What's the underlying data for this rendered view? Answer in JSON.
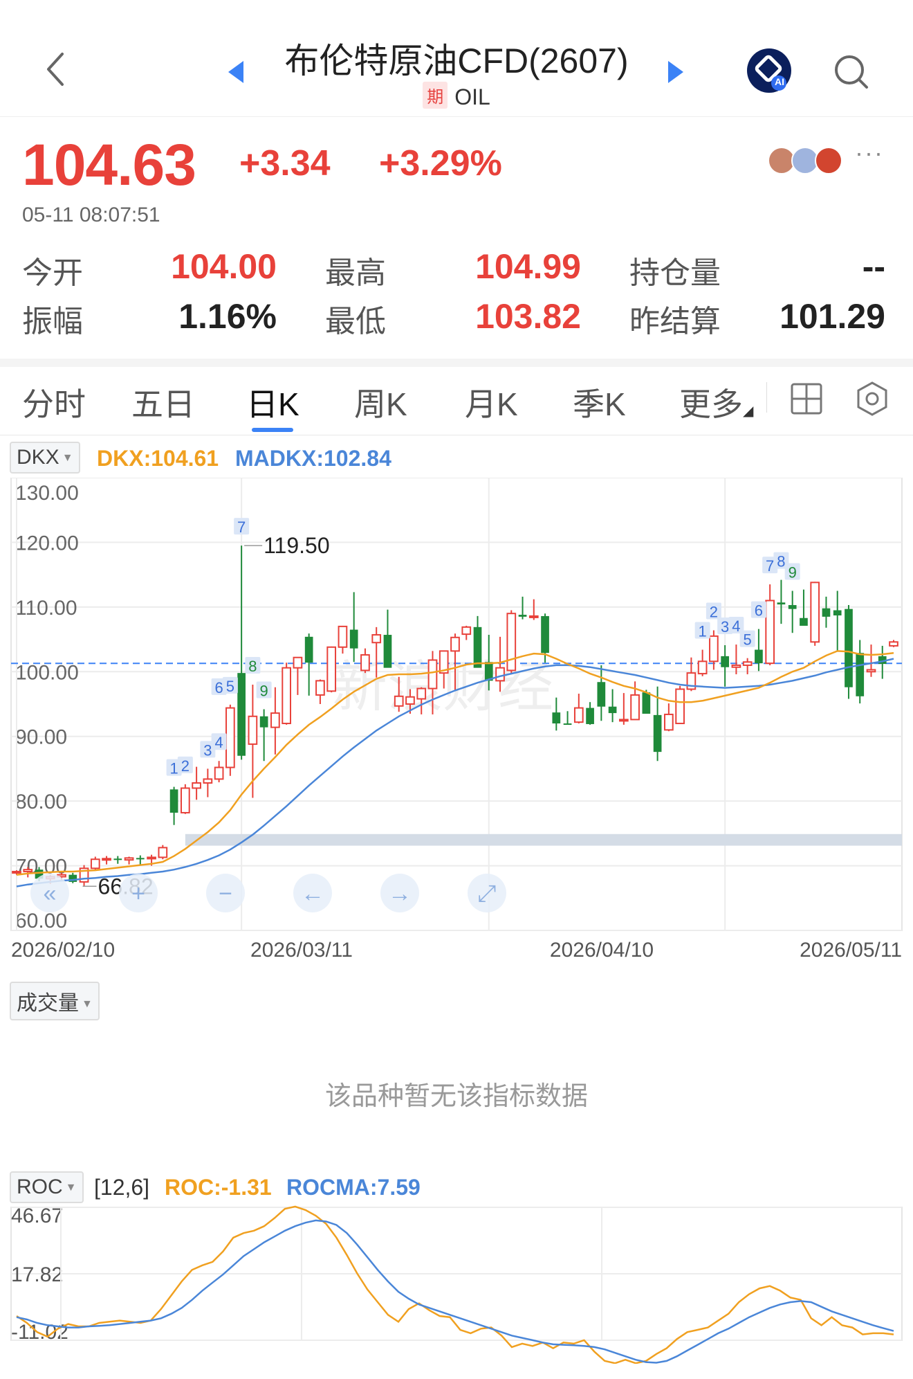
{
  "header": {
    "title": "布伦特原油CFD(2607)",
    "badge": "期",
    "symbol": "OIL",
    "ai_label": "AI"
  },
  "quote": {
    "price": "104.63",
    "change": "+3.34",
    "change_pct": "+3.29%",
    "timestamp": "05-11 08:07:51",
    "more": "···"
  },
  "stats": [
    {
      "label": "今开",
      "value": "104.00",
      "color": "#e8413a"
    },
    {
      "label": "最高",
      "value": "104.99",
      "color": "#e8413a"
    },
    {
      "label": "持仓量",
      "value": "--",
      "color": "#222222"
    },
    {
      "label": "振幅",
      "value": "1.16%",
      "color": "#222222"
    },
    {
      "label": "最低",
      "value": "103.82",
      "color": "#e8413a"
    },
    {
      "label": "昨结算",
      "value": "101.29",
      "color": "#222222"
    }
  ],
  "tabs": [
    "分时",
    "五日",
    "日K",
    "周K",
    "月K",
    "季K",
    "更多"
  ],
  "active_tab": "日K",
  "main_indicator": {
    "name": "DKX",
    "dkx": "DKX:104.61",
    "madkx": "MADKX:102.84",
    "dkx_color": "#f0a020",
    "madkx_color": "#4a86d8"
  },
  "volume_indicator": {
    "name": "成交量",
    "no_data": "该品种暂无该指标数据"
  },
  "roc_indicator": {
    "name": "ROC",
    "params": "[12,6]",
    "roc": "ROC:-1.31",
    "rocma": "ROCMA:7.59"
  },
  "chart_data": [
    {
      "type": "candlestick",
      "y_ticks": [
        "130.00",
        "120.00",
        "110.00",
        "100.00",
        "90.00",
        "80.00",
        "70.00",
        "60.00"
      ],
      "ylim": [
        60,
        130
      ],
      "x_ticks": [
        "2026/02/10",
        "2026/03/11",
        "2026/04/10",
        "2026/05/11"
      ],
      "annotations": {
        "max": "119.50",
        "min": "66.82"
      },
      "reference_price": 101.29,
      "up_color": "#e8413a",
      "down_color": "#1f8a3a",
      "candles": [
        [
          68.9,
          69.3,
          68.6,
          69.1
        ],
        [
          69.1,
          69.8,
          68.2,
          69.4
        ],
        [
          69.4,
          69.8,
          67.6,
          68.0
        ],
        [
          68.0,
          68.6,
          67.2,
          68.3
        ],
        [
          68.3,
          68.9,
          67.8,
          68.6
        ],
        [
          68.6,
          68.9,
          67.3,
          67.5
        ],
        [
          67.5,
          70.1,
          66.8,
          69.6
        ],
        [
          69.6,
          71.4,
          69.2,
          71.0
        ],
        [
          71.0,
          71.5,
          70.2,
          71.1
        ],
        [
          71.1,
          71.5,
          70.3,
          70.9
        ],
        [
          70.9,
          71.4,
          70.2,
          71.2
        ],
        [
          71.2,
          71.6,
          70.2,
          71.1
        ],
        [
          71.1,
          71.7,
          70.0,
          71.3
        ],
        [
          71.3,
          73.2,
          71.0,
          72.8
        ],
        [
          81.8,
          82.2,
          76.3,
          78.2
        ],
        [
          78.2,
          82.6,
          78.0,
          82.0
        ],
        [
          82.0,
          85.3,
          80.2,
          82.8
        ],
        [
          82.8,
          85.0,
          80.6,
          83.4
        ],
        [
          83.4,
          86.2,
          82.9,
          85.2
        ],
        [
          85.2,
          94.9,
          83.9,
          94.4
        ],
        [
          99.8,
          119.5,
          86.4,
          87.0
        ],
        [
          88.8,
          98.0,
          80.5,
          93.1
        ],
        [
          93.1,
          94.2,
          86.2,
          91.4
        ],
        [
          91.4,
          97.6,
          87.2,
          93.6
        ],
        [
          92.0,
          101.4,
          91.8,
          100.6
        ],
        [
          100.6,
          101.0,
          96.4,
          102.2
        ],
        [
          105.4,
          105.9,
          96.3,
          101.4
        ],
        [
          96.4,
          98.8,
          95.0,
          98.6
        ],
        [
          97.0,
          103.9,
          96.8,
          103.8
        ],
        [
          103.8,
          107.1,
          102.8,
          107.0
        ],
        [
          106.5,
          112.3,
          101.5,
          103.6
        ],
        [
          100.2,
          103.6,
          99.8,
          102.6
        ],
        [
          104.5,
          106.9,
          99.1,
          105.7
        ],
        [
          105.7,
          109.6,
          101.0,
          100.6
        ],
        [
          94.7,
          99.2,
          93.8,
          96.2
        ],
        [
          95.0,
          97.3,
          93.5,
          96.1
        ],
        [
          95.8,
          97.6,
          93.4,
          97.4
        ],
        [
          97.4,
          103.2,
          93.4,
          101.8
        ],
        [
          99.8,
          103.1,
          97.4,
          103.2
        ],
        [
          103.2,
          105.9,
          97.2,
          105.3
        ],
        [
          105.8,
          107.1,
          104.9,
          106.9
        ],
        [
          106.9,
          108.6,
          101.0,
          100.6
        ],
        [
          101.5,
          105.7,
          97.1,
          98.6
        ],
        [
          98.6,
          105.4,
          96.9,
          100.6
        ],
        [
          100.2,
          109.5,
          99.6,
          109.0
        ],
        [
          108.8,
          111.6,
          108.1,
          108.5
        ],
        [
          108.6,
          111.2,
          108.0,
          108.6
        ],
        [
          108.6,
          109.0,
          101.4,
          102.9
        ],
        [
          93.7,
          96.0,
          90.9,
          92.0
        ],
        [
          92.0,
          93.9,
          91.8,
          91.8
        ],
        [
          92.2,
          96.6,
          92.0,
          94.4
        ],
        [
          94.4,
          95.3,
          91.8,
          91.9
        ],
        [
          98.4,
          101.0,
          92.4,
          94.6
        ],
        [
          94.6,
          97.3,
          92.2,
          93.6
        ],
        [
          92.4,
          96.7,
          91.8,
          92.6
        ],
        [
          92.6,
          98.5,
          93.5,
          96.4
        ],
        [
          96.8,
          97.2,
          93.5,
          93.5
        ],
        [
          93.3,
          97.7,
          86.2,
          87.6
        ],
        [
          91.0,
          95.1,
          90.8,
          93.4
        ],
        [
          92.0,
          97.8,
          92.4,
          97.3
        ],
        [
          97.3,
          102.2,
          97.0,
          99.8
        ],
        [
          99.7,
          103.4,
          99.3,
          101.6
        ],
        [
          101.6,
          106.4,
          100.3,
          105.5
        ],
        [
          102.4,
          104.1,
          97.7,
          100.7
        ],
        [
          100.7,
          104.2,
          99.6,
          101.0
        ],
        [
          101.0,
          102.1,
          99.6,
          101.5
        ],
        [
          103.4,
          106.6,
          100.1,
          101.3
        ],
        [
          101.3,
          113.5,
          101.0,
          111.0
        ],
        [
          110.7,
          114.2,
          107.4,
          110.4
        ],
        [
          110.3,
          112.5,
          106.0,
          109.7
        ],
        [
          108.3,
          112.7,
          107.8,
          107.1
        ],
        [
          104.6,
          113.9,
          104.0,
          113.8
        ],
        [
          109.8,
          111.6,
          106.8,
          108.5
        ],
        [
          109.5,
          112.5,
          103.1,
          108.7
        ],
        [
          109.7,
          110.3,
          95.8,
          97.6
        ],
        [
          102.9,
          104.9,
          95.1,
          96.2
        ],
        [
          100.0,
          104.2,
          99.2,
          100.3
        ],
        [
          102.4,
          104.0,
          98.9,
          101.2
        ],
        [
          104.0,
          104.9,
          103.8,
          104.6
        ]
      ],
      "dkx": [
        68.6,
        68.8,
        68.9,
        69.0,
        69.1,
        69.1,
        69.2,
        69.3,
        69.5,
        69.7,
        69.9,
        70.1,
        70.3,
        70.6,
        71.5,
        72.6,
        73.9,
        75.2,
        76.7,
        78.6,
        81.0,
        83.1,
        85.0,
        86.8,
        88.7,
        90.3,
        91.8,
        93.0,
        94.3,
        95.7,
        96.9,
        97.9,
        98.9,
        99.5,
        99.6,
        99.6,
        99.7,
        99.9,
        100.2,
        100.6,
        101.1,
        101.3,
        101.3,
        101.4,
        101.9,
        102.4,
        102.8,
        102.7,
        102.0,
        101.2,
        100.5,
        99.7,
        99.1,
        98.4,
        97.8,
        97.4,
        96.8,
        96.0,
        95.5,
        95.3,
        95.3,
        95.5,
        95.9,
        96.3,
        96.7,
        97.1,
        97.5,
        98.3,
        99.2,
        100.0,
        100.6,
        101.6,
        102.5,
        103.2,
        103.1,
        102.7,
        102.6,
        102.7,
        102.9
      ],
      "madkx": [
        66.8,
        67.1,
        67.3,
        67.5,
        67.7,
        67.8,
        68.0,
        68.1,
        68.3,
        68.4,
        68.6,
        68.7,
        68.9,
        69.1,
        69.4,
        69.8,
        70.3,
        70.9,
        71.6,
        72.5,
        73.6,
        74.8,
        76.2,
        77.7,
        79.2,
        80.8,
        82.4,
        83.9,
        85.4,
        86.9,
        88.3,
        89.6,
        90.9,
        92.0,
        93.1,
        94.0,
        94.9,
        95.7,
        96.4,
        97.1,
        97.7,
        98.3,
        98.8,
        99.3,
        99.7,
        100.1,
        100.5,
        100.8,
        101.0,
        101.0,
        100.9,
        100.7,
        100.4,
        100.1,
        99.8,
        99.5,
        99.1,
        98.7,
        98.3,
        98.0,
        97.8,
        97.7,
        97.6,
        97.5,
        97.6,
        97.7,
        97.8,
        98.0,
        98.3,
        98.6,
        99.0,
        99.4,
        99.9,
        100.3,
        100.7,
        101.0,
        101.3,
        101.6,
        102.0
      ]
    },
    {
      "type": "line",
      "y_ticks": [
        "46.67",
        "17.82",
        "-11.02"
      ],
      "ylim": [
        -11.02,
        46.67
      ],
      "series": [
        {
          "name": "ROC",
          "color": "#f0a020",
          "values": [
            -0.5,
            -3.5,
            -7.5,
            -9.5,
            -6.0,
            -4.0,
            -5.0,
            -5.0,
            -3.5,
            -3.0,
            -2.5,
            -3.0,
            -3.5,
            -2.5,
            2.5,
            8.5,
            14.5,
            19.5,
            21.5,
            23.0,
            27.5,
            33.5,
            35.5,
            36.5,
            38.5,
            42.0,
            46.0,
            47.0,
            45.5,
            43.0,
            39.5,
            33.5,
            26.0,
            18.0,
            11.0,
            5.5,
            0.0,
            -3.0,
            2.5,
            5.0,
            2.0,
            -0.5,
            -1.0,
            -6.5,
            -8.0,
            -6.0,
            -5.5,
            -9.0,
            -14.0,
            -12.5,
            -13.5,
            -12.0,
            -14.5,
            -12.0,
            -12.5,
            -11.0,
            -16.0,
            -20.0,
            -21.0,
            -19.5,
            -21.0,
            -20.0,
            -17.0,
            -14.5,
            -10.5,
            -7.5,
            -6.5,
            -5.5,
            -2.5,
            0.5,
            5.5,
            9.0,
            11.5,
            12.5,
            10.5,
            7.5,
            6.5,
            -1.5,
            -4.5,
            -1.0,
            -4.5,
            -5.5,
            -8.5,
            -8.0,
            -8.0,
            -8.5
          ]
        },
        {
          "name": "ROCMA",
          "color": "#4a86d8",
          "values": [
            -1.0,
            -2.0,
            -3.5,
            -4.5,
            -5.0,
            -5.5,
            -5.5,
            -5.0,
            -4.8,
            -4.5,
            -4.0,
            -3.5,
            -3.0,
            -2.5,
            -1.5,
            0.5,
            3.0,
            6.5,
            10.5,
            14.0,
            17.5,
            21.5,
            25.5,
            28.5,
            31.5,
            34.0,
            36.5,
            38.5,
            40.0,
            41.0,
            40.5,
            39.0,
            35.5,
            30.5,
            25.0,
            19.5,
            14.5,
            10.0,
            7.0,
            4.5,
            3.0,
            1.5,
            0.0,
            -1.5,
            -3.0,
            -4.5,
            -6.0,
            -7.5,
            -9.0,
            -10.0,
            -11.0,
            -12.0,
            -12.8,
            -13.0,
            -13.2,
            -13.5,
            -14.0,
            -15.0,
            -16.5,
            -18.0,
            -19.5,
            -20.5,
            -20.8,
            -20.0,
            -18.0,
            -15.5,
            -13.0,
            -10.5,
            -8.0,
            -6.0,
            -3.5,
            -1.0,
            1.0,
            3.0,
            4.5,
            5.5,
            6.0,
            5.5,
            3.5,
            1.5,
            0.0,
            -1.5,
            -3.0,
            -4.5,
            -5.8,
            -7.0
          ]
        }
      ]
    }
  ]
}
